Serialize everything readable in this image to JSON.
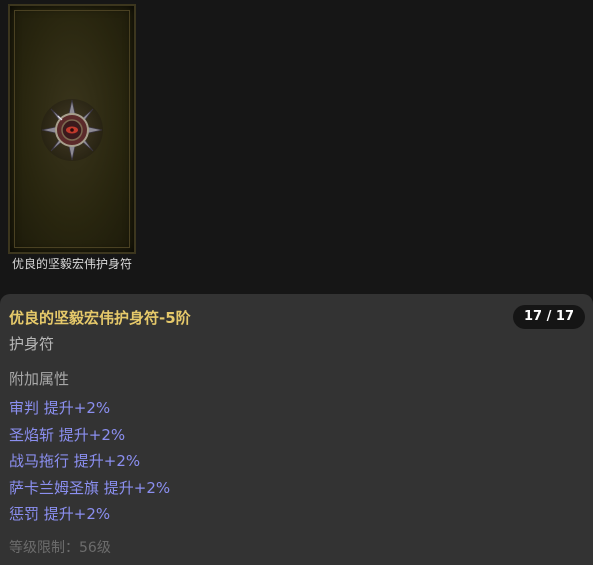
{
  "card": {
    "icon": "amulet-icon",
    "label": "优良的坚毅宏伟护身符"
  },
  "item": {
    "name": "优良的坚毅宏伟护身符-5阶",
    "count": "17 / 17",
    "type": "护身符",
    "attributes_header": "附加属性",
    "attributes": [
      "审判 提升+2%",
      "圣焰斩 提升+2%",
      "战马拖行 提升+2%",
      "萨卡兰姆圣旗 提升+2%",
      "惩罚 提升+2%"
    ],
    "level_requirement": "等级限制：56级"
  },
  "colors": {
    "name": "#e6c96a",
    "attribute": "#8b8ff0",
    "panel": "#333333",
    "background": "#161616"
  }
}
